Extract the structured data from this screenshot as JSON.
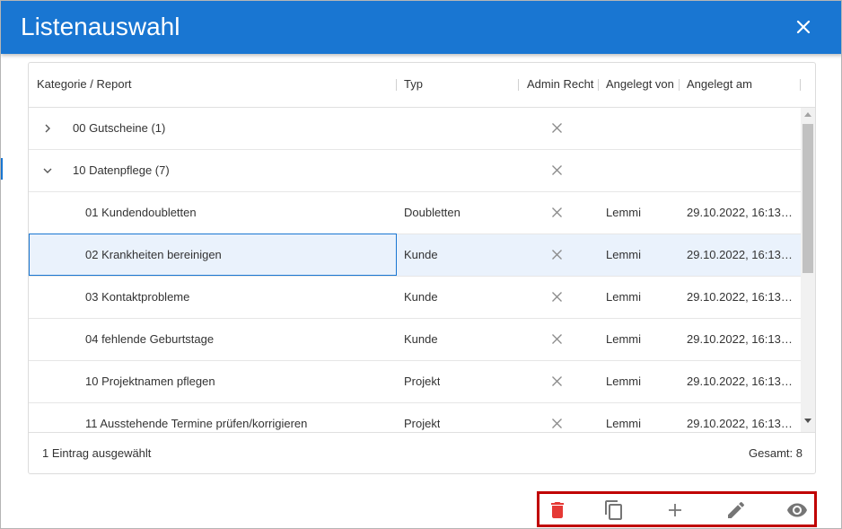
{
  "dialog": {
    "title": "Listenauswahl",
    "close_icon": "close-icon"
  },
  "grid": {
    "columns": [
      "Kategorie / Report",
      "Typ",
      "Admin Recht",
      "Angelegt von",
      "Angelegt am"
    ],
    "rows": [
      {
        "type": "group",
        "expanded": false,
        "name": "00 Gutscheine (1)",
        "typ": "",
        "admin": "x",
        "von": "",
        "am": ""
      },
      {
        "type": "group",
        "expanded": true,
        "name": "10 Datenpflege (7)",
        "typ": "",
        "admin": "x",
        "von": "",
        "am": ""
      },
      {
        "type": "item",
        "name": "01 Kundendoubletten",
        "typ": "Doubletten",
        "admin": "x",
        "von": "Lemmi",
        "am": "29.10.2022, 16:13…",
        "selected": false
      },
      {
        "type": "item",
        "name": "02 Krankheiten bereinigen",
        "typ": "Kunde",
        "admin": "x",
        "von": "Lemmi",
        "am": "29.10.2022, 16:13…",
        "selected": true
      },
      {
        "type": "item",
        "name": "03 Kontaktprobleme",
        "typ": "Kunde",
        "admin": "x",
        "von": "Lemmi",
        "am": "29.10.2022, 16:13…",
        "selected": false
      },
      {
        "type": "item",
        "name": "04 fehlende Geburtstage",
        "typ": "Kunde",
        "admin": "x",
        "von": "Lemmi",
        "am": "29.10.2022, 16:13…",
        "selected": false
      },
      {
        "type": "item",
        "name": "10 Projektnamen pflegen",
        "typ": "Projekt",
        "admin": "x",
        "von": "Lemmi",
        "am": "29.10.2022, 16:13…",
        "selected": false
      },
      {
        "type": "item",
        "name": "11 Ausstehende Termine prüfen/korrigieren",
        "typ": "Projekt",
        "admin": "x",
        "von": "Lemmi",
        "am": "29.10.2022, 16:13…",
        "selected": false
      }
    ],
    "footer": {
      "selection_text": "1 Eintrag ausgewählt",
      "total_text": "Gesamt: 8"
    }
  },
  "toolbar": {
    "buttons": [
      {
        "icon": "trash-icon",
        "color": "#e53935"
      },
      {
        "icon": "copy-icon",
        "color": "#757575"
      },
      {
        "icon": "plus-icon",
        "color": "#757575"
      },
      {
        "icon": "pencil-icon",
        "color": "#757575"
      },
      {
        "icon": "eye-icon",
        "color": "#757575"
      }
    ]
  },
  "colors": {
    "accent": "#1976d2",
    "selected_row": "#eaf2fc",
    "toolbar_highlight": "#c00000"
  }
}
